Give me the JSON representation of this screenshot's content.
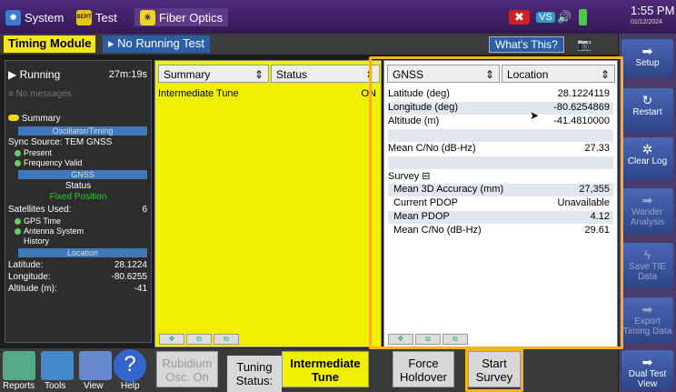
{
  "topbar": {
    "system": "System",
    "bert_icon": "BERT",
    "test": "Test",
    "fiber": "Fiber Optics",
    "time": "1:55 PM",
    "date": "01/12/2024",
    "status_icons": [
      "error-icon",
      "v-icon",
      "speaker-icon",
      "battery-icon"
    ]
  },
  "titlebar": {
    "module": "Timing Module",
    "running": "No Running Test",
    "whats_this": "What's This?"
  },
  "rail": {
    "setup": "Setup",
    "restart": "Restart",
    "clear_log": "Clear Log",
    "wander": "Wander Analysis",
    "save_tie": "Save TIE Data",
    "export": "Export Timing Data",
    "dual": "Dual Test View"
  },
  "left": {
    "running": "Running",
    "elapsed": "27m:19s",
    "messages": "No messages",
    "summary": "Summary",
    "osc_hdr": "Oscillator/Timing",
    "sync": "Sync Source:  TEM GNSS",
    "present": "Present",
    "freq": "Frequency Valid",
    "gnss_hdr": "GNSS",
    "status": "Status",
    "fixed": "Fixed Position",
    "sats": "Satellites Used:",
    "sats_val": "6",
    "gps": "GPS Time",
    "antenna": "Antenna System",
    "history": "History",
    "loc_hdr": "Location",
    "lat": "Latitude:",
    "lat_v": "28.1224",
    "lon": "Longitude:",
    "lon_v": "-80.6255",
    "alt": "Altitude (m):",
    "alt_v": "-41"
  },
  "center": {
    "h1": "Summary",
    "h2": "Status",
    "row": "Intermediate Tune",
    "row_v": "ON"
  },
  "right": {
    "h1": "GNSS",
    "h2": "Location",
    "rows": [
      [
        "Latitude (deg)",
        "28.1224119"
      ],
      [
        "Longitude (deg)",
        "-80.6254869"
      ],
      [
        "Altitude (m)",
        "-41.4810000"
      ],
      [
        "",
        ""
      ],
      [
        "Mean C/No (dB-Hz)",
        "27.33"
      ],
      [
        "",
        ""
      ],
      [
        "Survey ⊟",
        ""
      ],
      [
        "  Mean 3D Accuracy (mm)",
        "27,355"
      ],
      [
        "  Current PDOP",
        "Unavailable"
      ],
      [
        "  Mean PDOP",
        "4.12"
      ],
      [
        "  Mean C/No (dB-Hz)",
        "29.61"
      ]
    ]
  },
  "bottom": {
    "reports": "Reports",
    "tools": "Tools",
    "view": "View",
    "help": "Help",
    "rubidium": "Rubidium Osc. On",
    "tuning": "Tuning Status:",
    "intermediate": "Intermediate Tune",
    "force": "Force Holdover",
    "start": "Start Survey"
  }
}
